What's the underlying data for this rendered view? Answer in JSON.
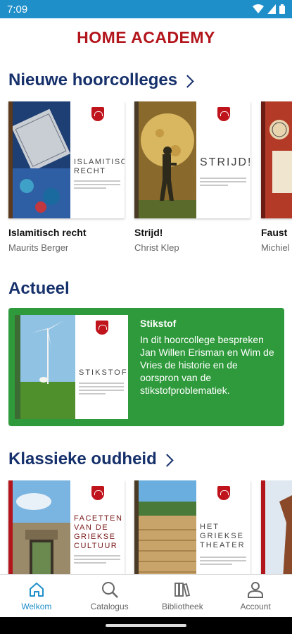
{
  "status": {
    "time": "7:09"
  },
  "app": {
    "title": "HOME ACADEMY"
  },
  "sections": {
    "nieuwe": {
      "title": "Nieuwe hoorcolleges",
      "items": [
        {
          "title": "Islamitisch recht",
          "author": "Maurits Berger",
          "cover_title": "ISLAMITISCH RECHT"
        },
        {
          "title": "Strijd!",
          "author": "Christ Klep",
          "cover_title": "STRIJD!"
        },
        {
          "title": "Faust",
          "author": "Michiel"
        }
      ]
    },
    "actueel": {
      "title": "Actueel",
      "feature": {
        "title": "Stikstof",
        "description": "In dit hoorcollege bespreken Jan Willen Erisman en Wim de Vries de historie en de oorspron van de stikstofproblematiek.",
        "cover_title": "STIKSTOF"
      }
    },
    "klassieke": {
      "title": "Klassieke oudheid",
      "items": [
        {
          "cover_title": "FACETTEN VAN DE GRIEKSE CULTUUR"
        },
        {
          "cover_title": "HET GRIEKSE THEATER"
        },
        {}
      ]
    }
  },
  "nav": {
    "items": [
      {
        "label": "Welkom",
        "icon": "home-icon",
        "active": true
      },
      {
        "label": "Catalogus",
        "icon": "search-icon"
      },
      {
        "label": "Bibliotheek",
        "icon": "library-icon"
      },
      {
        "label": "Account",
        "icon": "account-icon"
      }
    ]
  },
  "colors": {
    "accent": "#1e8fc9",
    "brand": "#b3151c",
    "heading": "#16306b",
    "feature_bg": "#2f9a3c"
  }
}
